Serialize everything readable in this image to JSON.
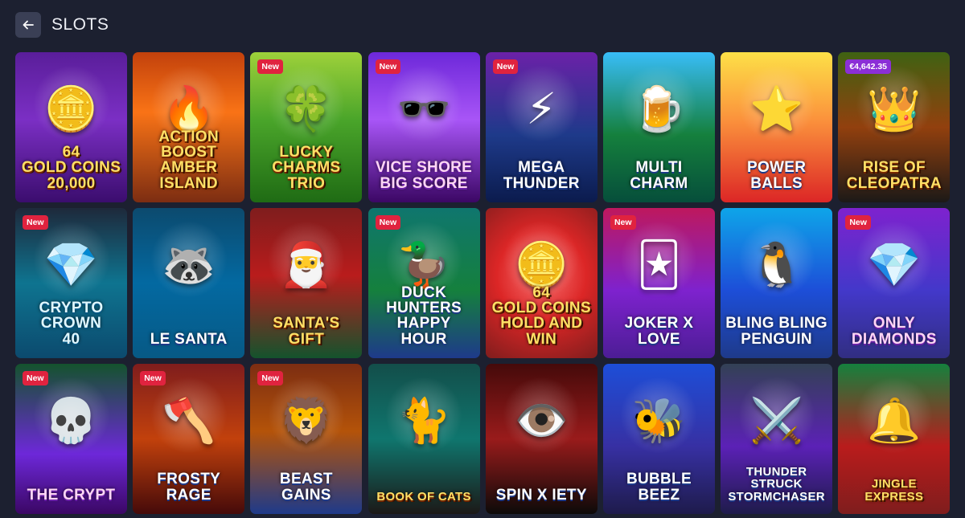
{
  "header": {
    "title": "SLOTS",
    "back_icon": "arrow-left-icon"
  },
  "badges": {
    "new": "New"
  },
  "tiles": [
    {
      "title": "64\nGOLD COINS\n20,000",
      "badge": "",
      "glyph": "🪙",
      "style": "c1"
    },
    {
      "title": "Action Boost\nAmber\nIsland",
      "badge": "",
      "glyph": "🔥",
      "style": "c2"
    },
    {
      "title": "Lucky\nCharms\nTrio",
      "badge": "new",
      "glyph": "🍀",
      "style": "c3"
    },
    {
      "title": "Vice Shore\nBig Score",
      "badge": "new",
      "glyph": "🕶️",
      "style": "c4"
    },
    {
      "title": "Mega\nThunder",
      "badge": "new",
      "glyph": "⚡",
      "style": "c5"
    },
    {
      "title": "Multi\nCharm",
      "badge": "",
      "glyph": "🍺",
      "style": "c6"
    },
    {
      "title": "Power\nBalls",
      "badge": "",
      "glyph": "⭐",
      "style": "c7"
    },
    {
      "title": "Rise of\nCleopatra",
      "badge": "jackpot",
      "jackpot": "€4,642.35",
      "glyph": "👑",
      "style": "c8"
    },
    {
      "title": "Crypto\nCrown\n40",
      "badge": "new",
      "glyph": "💎",
      "style": "c9"
    },
    {
      "title": "Le Santa",
      "badge": "",
      "glyph": "🦝",
      "style": "c10"
    },
    {
      "title": "Santa's Gift",
      "badge": "",
      "glyph": "🎅",
      "style": "c11"
    },
    {
      "title": "Duck Hunters\nHappy Hour",
      "badge": "new",
      "glyph": "🦆",
      "style": "c12"
    },
    {
      "title": "64\nGold Coins\nHold and Win",
      "badge": "",
      "glyph": "🪙",
      "style": "c13"
    },
    {
      "title": "Joker X Love",
      "badge": "new",
      "glyph": "🃏",
      "style": "c14"
    },
    {
      "title": "Bling Bling\nPenguin",
      "badge": "",
      "glyph": "🐧",
      "style": "c15"
    },
    {
      "title": "Only\nDiamonds",
      "badge": "new",
      "glyph": "💎",
      "style": "c16"
    },
    {
      "title": "The Crypt",
      "badge": "new",
      "glyph": "💀",
      "style": "c17"
    },
    {
      "title": "Frosty\nRage",
      "badge": "new",
      "glyph": "🪓",
      "style": "c18"
    },
    {
      "title": "Beast\nGains",
      "badge": "new",
      "glyph": "🦁",
      "style": "c19"
    },
    {
      "title": "Book of Cats",
      "badge": "",
      "glyph": "🐈",
      "style": "c20"
    },
    {
      "title": "SPIN X IETY",
      "badge": "",
      "glyph": "👁️",
      "style": "c21"
    },
    {
      "title": "Bubble\nBeez",
      "badge": "",
      "glyph": "🐝",
      "style": "c22"
    },
    {
      "title": "Thunder\nStruck\nStormchaser",
      "badge": "",
      "glyph": "⚔️",
      "style": "c23"
    },
    {
      "title": "Jingle\nExpress",
      "badge": "",
      "glyph": "🔔",
      "style": "c24"
    }
  ]
}
